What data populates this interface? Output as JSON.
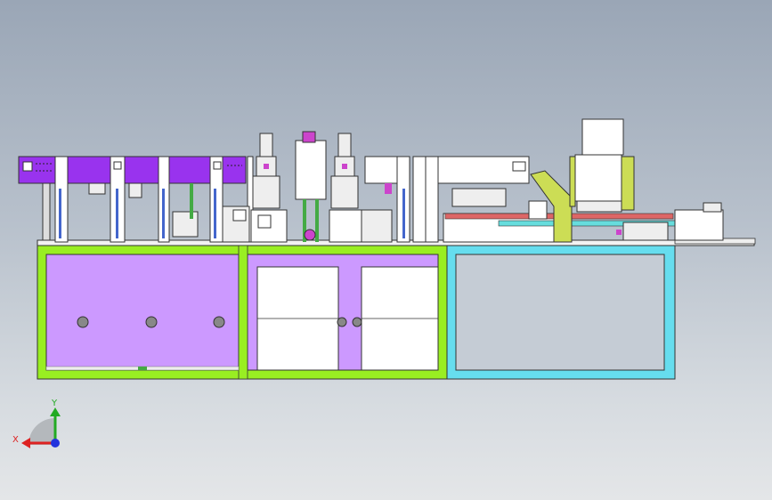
{
  "view": {
    "background_top": "#9aa6b6",
    "background_bottom": "#e4e6e8"
  },
  "colors": {
    "frame_green": "#99ee22",
    "frame_cyan": "#66ddee",
    "panel_purple": "#cc99ff",
    "module_purple": "#9933ee",
    "cover_yellow": "#ccdd55",
    "door_white": "#ffffff",
    "axis_x": "#dd2222",
    "axis_y": "#22aa22",
    "axis_z": "#2233dd"
  },
  "triad": {
    "x_label": "X",
    "y_label": "Y"
  }
}
